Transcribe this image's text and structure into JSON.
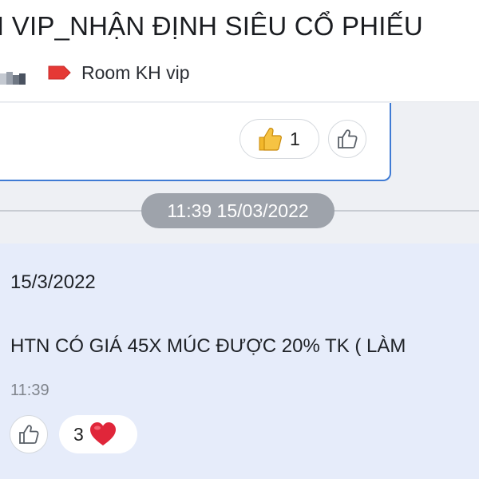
{
  "header": {
    "title": "I VIP_NHẬN ĐỊNH SIÊU CỔ PHIẾU",
    "room_label": "Room KH vip",
    "tag_color": "#e53935",
    "tag_icon": "label-tag-icon"
  },
  "previous_message": {
    "reaction_icon": "thumbs-up-emoji",
    "reaction_count": "1",
    "react_icon": "thumbs-up-outline-icon"
  },
  "time_separator": "11:39 15/03/2022",
  "message": {
    "date_line": "15/3/2022",
    "body": "HTN CÓ GIÁ 45X MÚC ĐƯỢC 20% TK ( LÀM",
    "time": "11:39",
    "react_icon": "thumbs-up-outline-icon",
    "reaction_count": "3",
    "reaction_icon": "heart-emoji",
    "reaction_color": "#e0263a"
  },
  "colors": {
    "accent_border": "#3f7bd4",
    "message_bg": "#e6ecfa",
    "separator_pill": "#9ea3ab"
  }
}
